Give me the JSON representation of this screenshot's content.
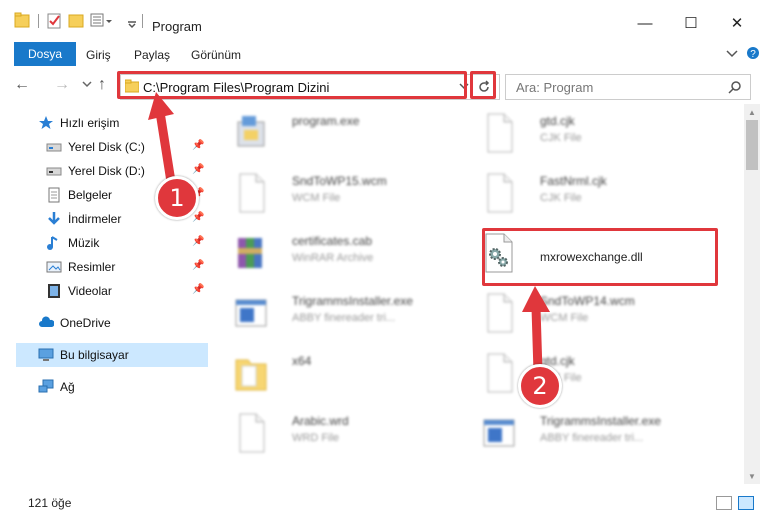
{
  "window": {
    "title": "Program"
  },
  "ribbon": {
    "tabs": [
      "Dosya",
      "Giriş",
      "Paylaş",
      "Görünüm"
    ]
  },
  "address": {
    "path": "C:\\Program Files\\Program Dizini"
  },
  "search": {
    "placeholder": "Ara: Program"
  },
  "sidebar": {
    "items": [
      {
        "label": "Hızlı erişim",
        "icon": "star-icon"
      },
      {
        "label": "Yerel Disk (C:)",
        "icon": "drive-icon",
        "pinned": true
      },
      {
        "label": "Yerel Disk (D:)",
        "icon": "drive-icon",
        "pinned": true
      },
      {
        "label": "Belgeler",
        "icon": "document-icon",
        "pinned": true
      },
      {
        "label": "İndirmeler",
        "icon": "download-icon",
        "pinned": true
      },
      {
        "label": "Müzik",
        "icon": "music-icon",
        "pinned": true
      },
      {
        "label": "Resimler",
        "icon": "pictures-icon",
        "pinned": true
      },
      {
        "label": "Videolar",
        "icon": "video-icon",
        "pinned": true
      },
      {
        "label": "OneDrive",
        "icon": "cloud-icon"
      },
      {
        "label": "Bu bilgisayar",
        "icon": "computer-icon",
        "selected": true
      },
      {
        "label": "Ağ",
        "icon": "network-icon"
      }
    ]
  },
  "files": [
    {
      "name": "program.exe",
      "type": ""
    },
    {
      "name": "gtd.cjk",
      "type": "CJK File"
    },
    {
      "name": "SndToWP15.wcm",
      "type": "WCM File"
    },
    {
      "name": "FastNrml.cjk",
      "type": "CJK File"
    },
    {
      "name": "certificates.cab",
      "type": "WinRAR Archive"
    },
    {
      "name": "mxrowexchange.dll",
      "type": ""
    },
    {
      "name": "TrigrammsInstaller.exe",
      "type": "ABBY finereader tri..."
    },
    {
      "name": "SndToWP14.wcm",
      "type": "WCM File"
    },
    {
      "name": "x64",
      "type": ""
    },
    {
      "name": "gtd.cjk",
      "type": "CJK File"
    },
    {
      "name": "Arabic.wrd",
      "type": "WRD File"
    },
    {
      "name": "TrigrammsInstaller.exe",
      "type": "ABBY finereader tri..."
    }
  ],
  "status": {
    "count": "121 öğe"
  },
  "callouts": [
    "1",
    "2"
  ],
  "colors": {
    "accent": "#1979ca",
    "highlight": "#e0373c",
    "selected": "#cce8ff"
  }
}
